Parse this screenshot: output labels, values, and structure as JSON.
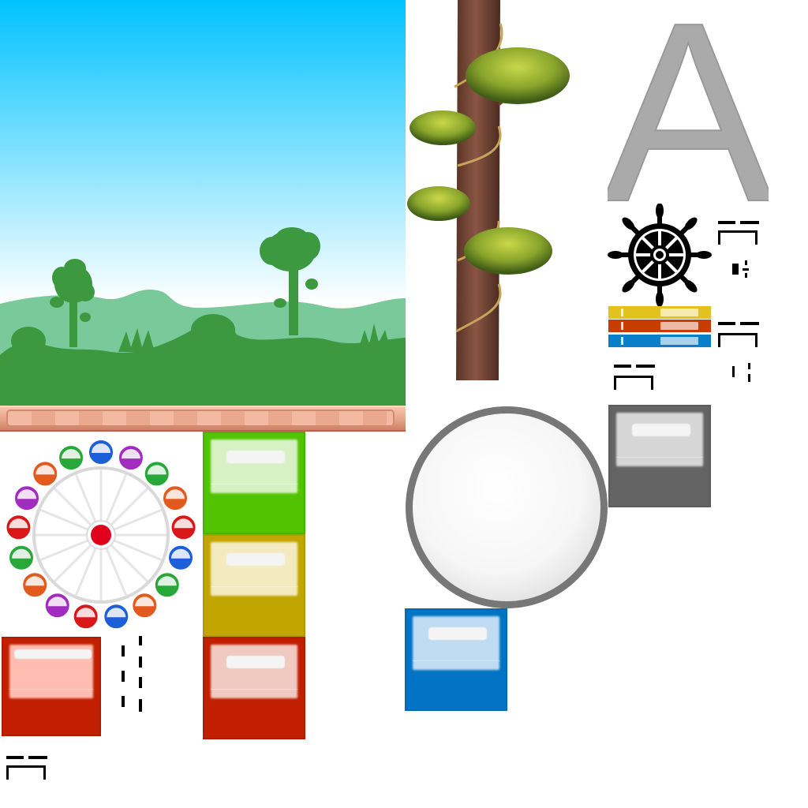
{
  "atlas": {
    "letter": "A",
    "colors": {
      "sky_top": "#00c2ff",
      "sky_bottom": "#ffffff",
      "hill_back": "#79c99a",
      "grass": "#3c993f",
      "letter_gray": "#aaaaaa",
      "circle_rim": "#777777"
    }
  },
  "sprites": [
    {
      "id": "landscape-background",
      "icon": "landscape-icon"
    },
    {
      "id": "beanstalk-tree",
      "icon": "tree-icon"
    },
    {
      "id": "letter-glyph",
      "icon": "letter-a-icon"
    },
    {
      "id": "ship-wheel",
      "icon": "ship-wheel-icon"
    },
    {
      "id": "ferris-wheel",
      "icon": "ferris-wheel-icon"
    },
    {
      "id": "wooden-plank",
      "icon": "plank-icon"
    },
    {
      "id": "white-orb",
      "icon": "circle-icon"
    }
  ],
  "crates": [
    {
      "name": "green",
      "base": "#52c300",
      "panel": "#d7f1c4"
    },
    {
      "name": "yellow",
      "base": "#c2a600",
      "panel": "#f3ebbf"
    },
    {
      "name": "red",
      "base": "#c11f00",
      "panel": "#f0c9c1"
    },
    {
      "name": "red-left",
      "base": "#c11f00",
      "panel": "#ffbcb0"
    },
    {
      "name": "blue",
      "base": "#0173c4",
      "panel": "#bfdcf3"
    },
    {
      "name": "gray",
      "base": "#646464",
      "panel": "#d6d6d6"
    }
  ],
  "flags": [
    {
      "color": "#e2c21e"
    },
    {
      "color": "#c83c00"
    },
    {
      "color": "#0a7fc9"
    }
  ],
  "ferris_cabins": [
    "#1d5fd8",
    "#a22cc0",
    "#29a83a",
    "#e25a1e",
    "#d81818",
    "#1d5fd8",
    "#29a83a",
    "#e25a1e",
    "#1d5fd8",
    "#d81818",
    "#a22cc0",
    "#e25a1e",
    "#29a83a",
    "#d81818",
    "#a22cc0",
    "#e25a1e",
    "#29a83a"
  ]
}
